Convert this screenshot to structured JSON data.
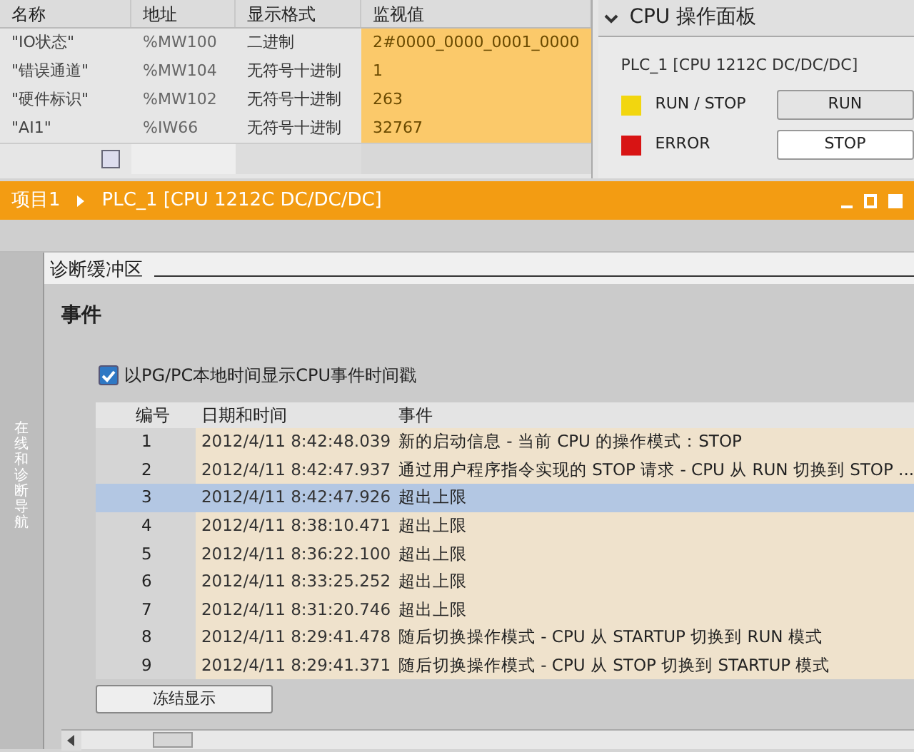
{
  "watch_table": {
    "columns": [
      "名称",
      "地址",
      "显示格式",
      "监视值"
    ],
    "rows": [
      {
        "name": "\"IO状态\"",
        "address": "%MW100",
        "format": "二进制",
        "value": "2#0000_0000_0001_0000"
      },
      {
        "name": "\"错误通道\"",
        "address": "%MW104",
        "format": "无符号十进制",
        "value": "1"
      },
      {
        "name": "\"硬件标识\"",
        "address": "%MW102",
        "format": "无符号十进制",
        "value": "263"
      },
      {
        "name": "\"AI1\"",
        "address": "%IW66",
        "format": "无符号十进制",
        "value": "32767"
      }
    ]
  },
  "cpu_panel": {
    "title": "CPU 操作面板",
    "device": "PLC_1 [CPU 1212C DC/DC/DC]",
    "leds": [
      {
        "label": "RUN / STOP",
        "color": "#f2d60f",
        "button": "RUN"
      },
      {
        "label": "ERROR",
        "color": "#d81414",
        "button": "STOP"
      }
    ]
  },
  "window": {
    "breadcrumb": [
      "项目1",
      "PLC_1 [CPU 1212C DC/DC/DC]"
    ]
  },
  "sidebar": {
    "label": "在线和诊断导航"
  },
  "section": {
    "title": "诊断缓冲区",
    "group": "事件",
    "checkbox": {
      "label": "以PG/PC本地时间显示CPU事件时间戳",
      "checked": true
    },
    "table": {
      "columns": [
        "编号",
        "日期和时间",
        "事件"
      ],
      "rows": [
        {
          "no": "1",
          "time": "2012/4/11 8:42:48.039",
          "event": "新的启动信息 - 当前 CPU 的操作模式：STOP",
          "selected": false
        },
        {
          "no": "2",
          "time": "2012/4/11 8:42:47.937",
          "event": "通过用户程序指令实现的 STOP 请求 - CPU 从 RUN 切换到 STOP ...",
          "selected": false
        },
        {
          "no": "3",
          "time": "2012/4/11 8:42:47.926",
          "event": "超出上限",
          "selected": true
        },
        {
          "no": "4",
          "time": "2012/4/11 8:38:10.471",
          "event": "超出上限",
          "selected": false
        },
        {
          "no": "5",
          "time": "2012/4/11 8:36:22.100",
          "event": "超出上限",
          "selected": false
        },
        {
          "no": "6",
          "time": "2012/4/11 8:33:25.252",
          "event": "超出上限",
          "selected": false
        },
        {
          "no": "7",
          "time": "2012/4/11 8:31:20.746",
          "event": "超出上限",
          "selected": false
        },
        {
          "no": "8",
          "time": "2012/4/11 8:29:41.478",
          "event": "随后切换操作模式 - CPU 从 STARTUP 切换到 RUN 模式",
          "selected": false
        },
        {
          "no": "9",
          "time": "2012/4/11 8:29:41.371",
          "event": "随后切换操作模式 - CPU 从 STOP 切换到 STARTUP 模式",
          "selected": false
        }
      ]
    },
    "button": "冻结显示"
  }
}
